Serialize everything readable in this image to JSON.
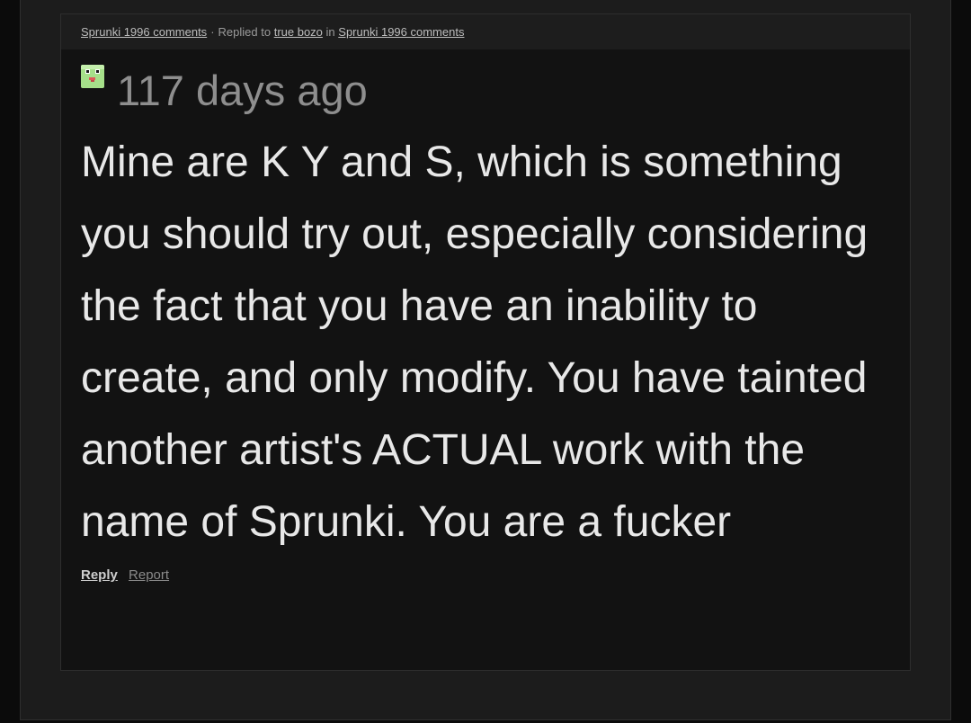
{
  "header": {
    "source_link": "Sprunki 1996 comments",
    "separator": "·",
    "replied_to_prefix": "Replied to",
    "replied_to_user": "true bozo",
    "in_word": "in",
    "location_link": "Sprunki 1996 comments"
  },
  "comment": {
    "avatar_icon": "frog-avatar-icon",
    "timestamp": "117 days ago",
    "text": "Mine are K Y and S, which is something you should try out, especially considering the fact that you have an inability to create, and only modify. You have tainted another artist's ACTUAL work with the name of Sprunki. You are a fucker"
  },
  "actions": {
    "reply_label": "Reply",
    "report_label": "Report"
  },
  "colors": {
    "background": "#0b0b0b",
    "column": "#1c1c1c",
    "card": "#121212",
    "header": "#1d1d1d",
    "text": "#e8e8e8",
    "muted": "#8e8e8e",
    "avatar_green": "#a6e08a"
  }
}
